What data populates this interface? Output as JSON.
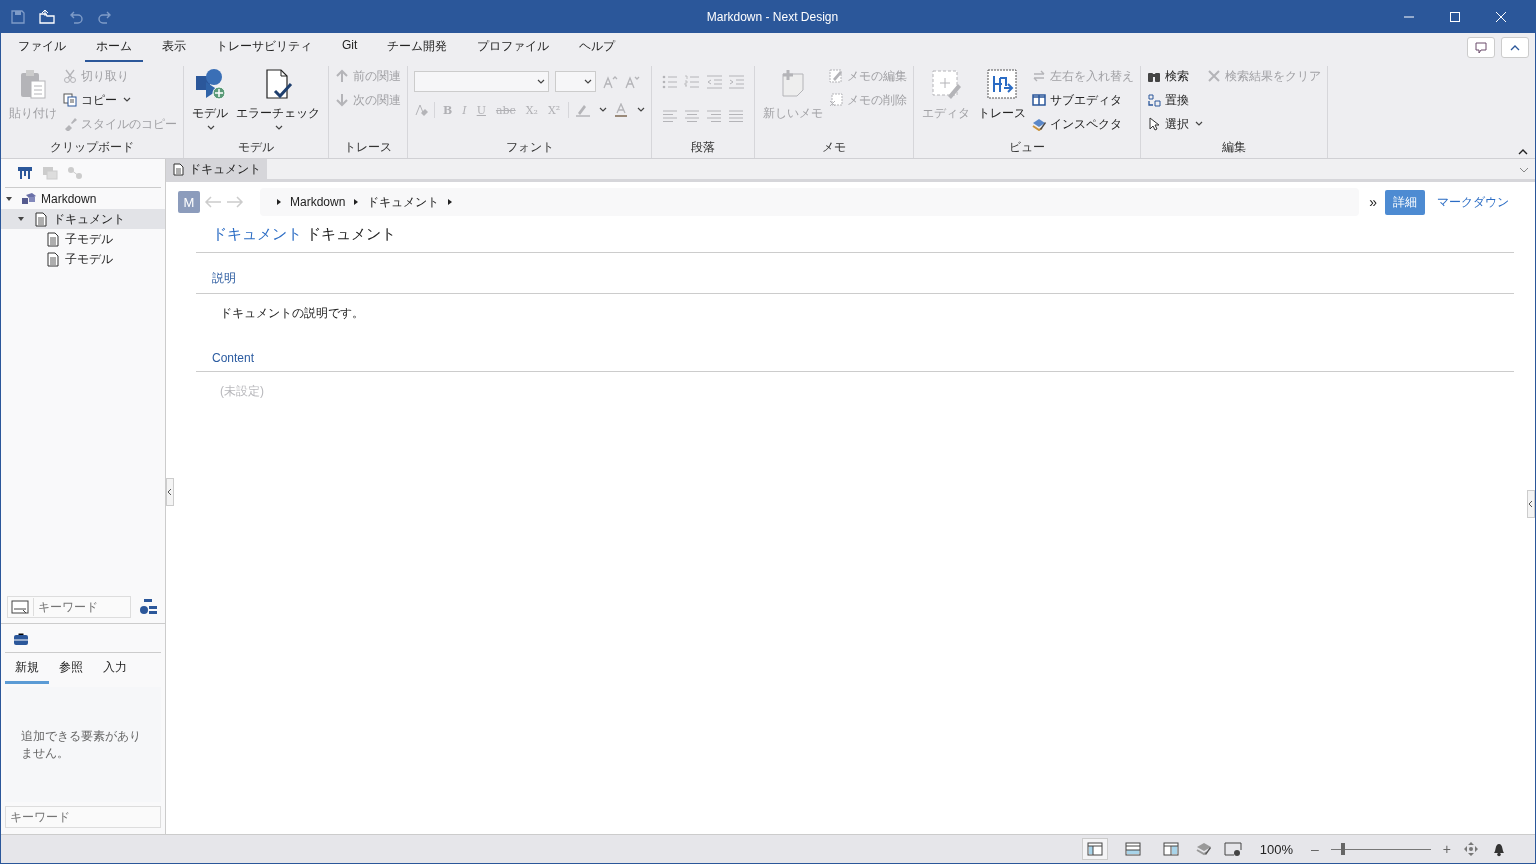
{
  "window": {
    "title": "Markdown - Next Design"
  },
  "menu_tabs": [
    {
      "label": "ファイル",
      "selected": false
    },
    {
      "label": "ホーム",
      "selected": true
    },
    {
      "label": "表示",
      "selected": false
    },
    {
      "label": "トレーサビリティ",
      "selected": false
    },
    {
      "label": "Git",
      "selected": false
    },
    {
      "label": "チーム開発",
      "selected": false
    },
    {
      "label": "プロファイル",
      "selected": false
    },
    {
      "label": "ヘルプ",
      "selected": false
    }
  ],
  "ribbon": {
    "groups": [
      {
        "label": "クリップボード",
        "kind": "buttons",
        "columns": [
          [
            {
              "kind": "large",
              "label": "貼り付け",
              "disabled": true,
              "dropdown": false
            }
          ],
          [
            {
              "kind": "small",
              "label": "切り取り",
              "disabled": true,
              "dropdown": false
            },
            {
              "kind": "small",
              "label": "コピー",
              "disabled": false,
              "dropdown": true
            },
            {
              "kind": "small",
              "label": "スタイルのコピー",
              "disabled": true,
              "dropdown": false
            }
          ]
        ]
      },
      {
        "label": "モデル",
        "kind": "buttons",
        "columns": [
          [
            {
              "kind": "large",
              "label": "モデル",
              "disabled": false,
              "dropdown": true
            }
          ],
          [
            {
              "kind": "large",
              "label": "エラーチェック",
              "disabled": false,
              "dropdown": true
            }
          ]
        ]
      },
      {
        "label": "トレース",
        "kind": "buttons",
        "columns": [
          [
            {
              "kind": "small",
              "label": "前の関連",
              "disabled": true,
              "dropdown": false
            },
            {
              "kind": "small",
              "label": "次の関連",
              "disabled": true,
              "dropdown": false
            }
          ]
        ]
      },
      {
        "label": "フォント",
        "kind": "font",
        "glyphs": [
          "B",
          "I",
          "U",
          "abc",
          "X₂",
          "X²"
        ]
      },
      {
        "label": "段落",
        "kind": "paragraph"
      },
      {
        "label": "メモ",
        "kind": "buttons",
        "columns": [
          [
            {
              "kind": "large",
              "label": "新しいメモ",
              "disabled": true,
              "dropdown": false
            }
          ],
          [
            {
              "kind": "small",
              "label": "メモの編集",
              "disabled": true,
              "dropdown": false
            },
            {
              "kind": "small",
              "label": "メモの削除",
              "disabled": true,
              "dropdown": false
            }
          ]
        ]
      },
      {
        "label": "ビュー",
        "kind": "buttons",
        "columns": [
          [
            {
              "kind": "large",
              "label": "エディタ",
              "disabled": true,
              "dropdown": false
            }
          ],
          [
            {
              "kind": "large",
              "label": "トレース",
              "disabled": false,
              "dropdown": false
            }
          ],
          [
            {
              "kind": "small",
              "label": "左右を入れ替え",
              "disabled": true,
              "dropdown": false
            },
            {
              "kind": "small",
              "label": "サブエディタ",
              "disabled": false,
              "dropdown": false
            },
            {
              "kind": "small",
              "label": "インスペクタ",
              "disabled": false,
              "dropdown": false
            }
          ]
        ]
      },
      {
        "label": "編集",
        "kind": "buttons",
        "columns": [
          [
            {
              "kind": "small",
              "label": "検索",
              "disabled": false,
              "dropdown": false
            },
            {
              "kind": "small",
              "label": "置換",
              "disabled": false,
              "dropdown": false
            },
            {
              "kind": "small",
              "label": "選択",
              "disabled": false,
              "dropdown": true
            }
          ],
          [
            {
              "kind": "small",
              "label": "検索結果をクリア",
              "disabled": true,
              "dropdown": false
            }
          ]
        ]
      }
    ]
  },
  "doc_tabs": [
    {
      "label": "ドキュメント",
      "selected": true
    }
  ],
  "tree": [
    {
      "label": "Markdown",
      "kind": "project",
      "expanded": true,
      "selected": false,
      "children": [
        {
          "label": "ドキュメント",
          "kind": "document",
          "expanded": true,
          "selected": true,
          "children": [
            {
              "label": "子モデル",
              "kind": "document",
              "selected": false
            },
            {
              "label": "子モデル",
              "kind": "document",
              "selected": false
            }
          ]
        }
      ]
    }
  ],
  "tree_search": {
    "placeholder": "キーワード"
  },
  "toolbox": {
    "tabs": [
      {
        "label": "新規",
        "selected": true
      },
      {
        "label": "参照",
        "selected": false
      },
      {
        "label": "入力",
        "selected": false
      }
    ],
    "message": "追加できる要素がありません。",
    "search": {
      "placeholder": "キーワード"
    }
  },
  "editor": {
    "avatar": "M",
    "breadcrumb": [
      "Markdown",
      "ドキュメント"
    ],
    "overflow": "»",
    "view_buttons": [
      {
        "label": "詳細",
        "selected": true
      },
      {
        "label": "マークダウン",
        "selected": false
      }
    ],
    "title_type": "ドキュメント",
    "title_name": "ドキュメント",
    "fields": [
      {
        "label": "説明",
        "value": "ドキュメントの説明です。",
        "unset": false
      },
      {
        "label": "Content",
        "value": "(未設定)",
        "unset": true
      }
    ]
  },
  "status_bar": {
    "layouts": [
      {
        "selected": true
      },
      {
        "selected": false
      },
      {
        "selected": false
      }
    ],
    "zoom": "100%",
    "minus": "–",
    "plus": "+",
    "zoom_slider": {
      "level": 0.12
    }
  }
}
